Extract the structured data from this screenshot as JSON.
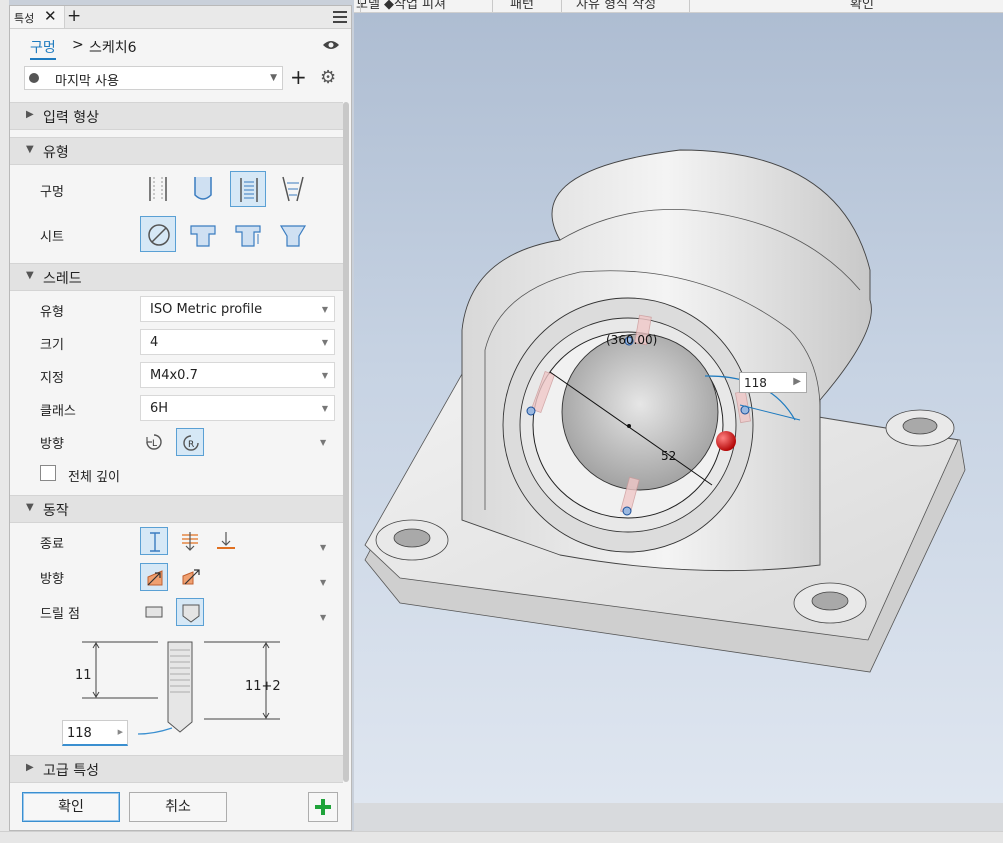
{
  "ribbon": {
    "items": [
      "모델 ◆",
      "작업 피쳐",
      "패턴",
      "자유 형식 작성",
      "확인"
    ]
  },
  "panel": {
    "tab_label": "특성",
    "breadcrumb": {
      "feature": "구멍",
      "separator": ">",
      "sketch": "스케치6"
    },
    "history_combo": "마지막 사용",
    "sections": {
      "input": "입력 형상",
      "type": "유형",
      "thread": "스레드",
      "behavior": "동작",
      "advanced": "고급 특성"
    },
    "type": {
      "hole_label": "구멍",
      "seat_label": "시트"
    },
    "thread": {
      "type_label": "유형",
      "type_value": "ISO Metric profile",
      "size_label": "크기",
      "size_value": "4",
      "designation_label": "지정",
      "designation_value": "M4x0.7",
      "class_label": "클래스",
      "class_value": "6H",
      "direction_label": "방향",
      "full_depth_label": "전체 깊이"
    },
    "behavior": {
      "termination_label": "종료",
      "direction_label": "방향",
      "drill_point_label": "드릴 점",
      "depth_left": "11",
      "depth_right": "11+2",
      "drill_angle": "118"
    },
    "buttons": {
      "ok": "확인",
      "cancel": "취소"
    }
  },
  "viewport": {
    "angle_dimension": "(360.00)",
    "diameter_dimension": "52",
    "angle_input_value": "118"
  },
  "colors": {
    "accent": "#1f7bbf",
    "selected_bg": "#d6e8f6",
    "add_green": "#1fa33a",
    "grip_red": "#cc1111"
  },
  "icons": [
    "close-icon",
    "plus-icon",
    "menu-icon",
    "eye-icon",
    "clock-icon",
    "gear-icon",
    "chevron-down-icon",
    "check-plus-icon"
  ]
}
